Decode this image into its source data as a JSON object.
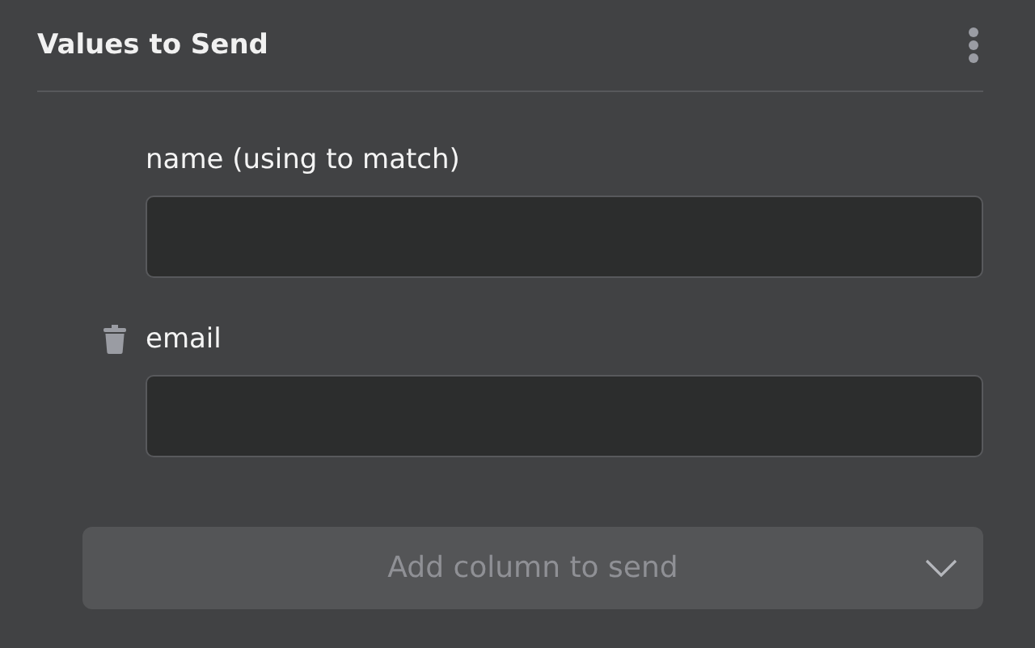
{
  "panel": {
    "title": "Values to Send"
  },
  "fields": [
    {
      "label": "name (using to match)",
      "deletable": false
    },
    {
      "label": "email",
      "deletable": true
    }
  ],
  "add_dropdown": {
    "placeholder": "Add column to send"
  }
}
